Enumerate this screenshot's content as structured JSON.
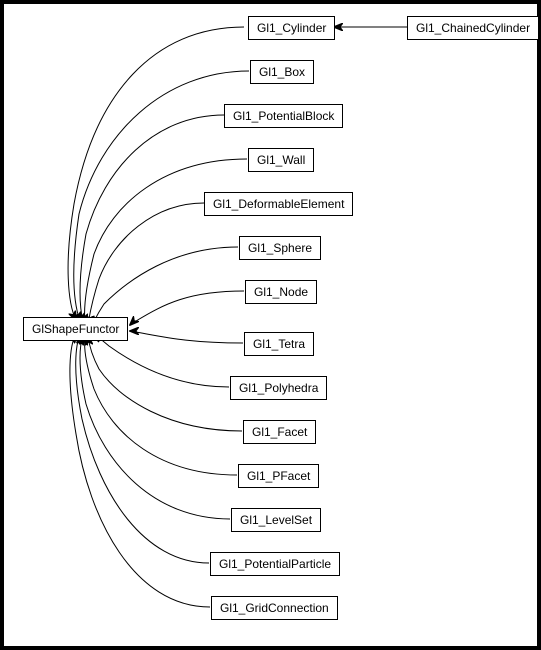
{
  "chart_data": {
    "type": "graph",
    "nodes": [
      {
        "id": "root",
        "label": "GlShapeFunctor"
      },
      {
        "id": "cylinder",
        "label": "Gl1_Cylinder"
      },
      {
        "id": "chained",
        "label": "Gl1_ChainedCylinder"
      },
      {
        "id": "box",
        "label": "Gl1_Box"
      },
      {
        "id": "potblock",
        "label": "Gl1_PotentialBlock"
      },
      {
        "id": "wall",
        "label": "Gl1_Wall"
      },
      {
        "id": "deform",
        "label": "Gl1_DeformableElement"
      },
      {
        "id": "sphere",
        "label": "Gl1_Sphere"
      },
      {
        "id": "node",
        "label": "Gl1_Node"
      },
      {
        "id": "tetra",
        "label": "Gl1_Tetra"
      },
      {
        "id": "poly",
        "label": "Gl1_Polyhedra"
      },
      {
        "id": "facet",
        "label": "Gl1_Facet"
      },
      {
        "id": "pfacet",
        "label": "Gl1_PFacet"
      },
      {
        "id": "levelset",
        "label": "Gl1_LevelSet"
      },
      {
        "id": "potpart",
        "label": "Gl1_PotentialParticle"
      },
      {
        "id": "gridconn",
        "label": "Gl1_GridConnection"
      }
    ],
    "edges": [
      {
        "from": "cylinder",
        "to": "root"
      },
      {
        "from": "chained",
        "to": "cylinder"
      },
      {
        "from": "box",
        "to": "root"
      },
      {
        "from": "potblock",
        "to": "root"
      },
      {
        "from": "wall",
        "to": "root"
      },
      {
        "from": "deform",
        "to": "root"
      },
      {
        "from": "sphere",
        "to": "root"
      },
      {
        "from": "node",
        "to": "root"
      },
      {
        "from": "tetra",
        "to": "root"
      },
      {
        "from": "poly",
        "to": "root"
      },
      {
        "from": "facet",
        "to": "root"
      },
      {
        "from": "pfacet",
        "to": "root"
      },
      {
        "from": "levelset",
        "to": "root"
      },
      {
        "from": "potpart",
        "to": "root"
      },
      {
        "from": "gridconn",
        "to": "root"
      }
    ]
  }
}
